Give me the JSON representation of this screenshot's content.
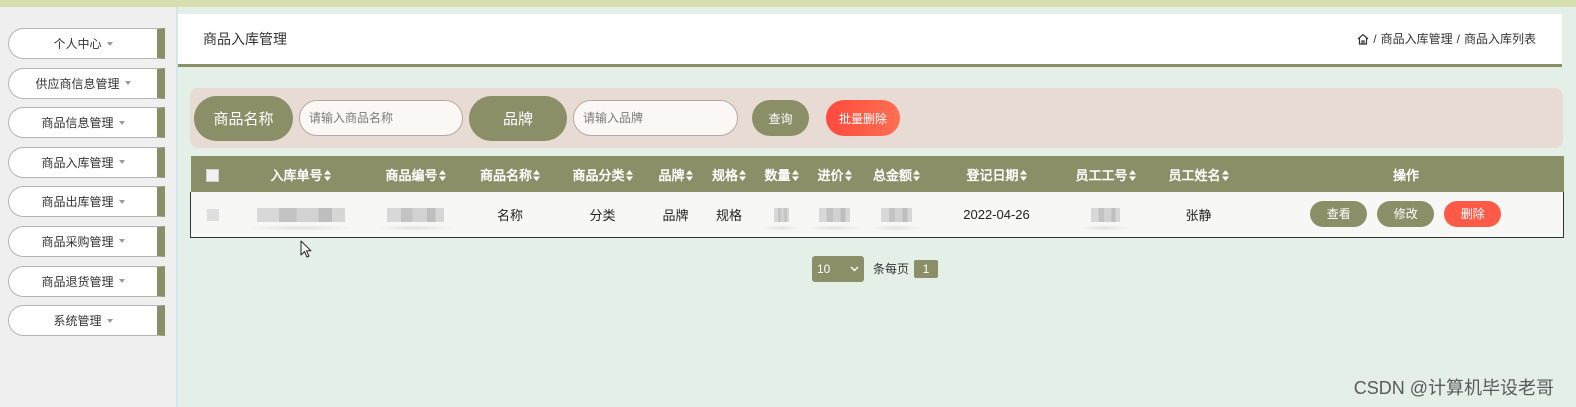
{
  "colors": {
    "accent": "#8b8f68",
    "danger": "#ff5a48",
    "search_panel_bg": "#e8dbd3",
    "main_bg": "#e3efe7"
  },
  "icons": {
    "home": "home-icon",
    "sort": "sort-icon",
    "dropdown": "caret-down-icon"
  },
  "sidebar": {
    "items": [
      {
        "label": "个人中心"
      },
      {
        "label": "供应商信息管理"
      },
      {
        "label": "商品信息管理"
      },
      {
        "label": "商品入库管理"
      },
      {
        "label": "商品出库管理"
      },
      {
        "label": "商品采购管理"
      },
      {
        "label": "商品退货管理"
      },
      {
        "label": "系统管理"
      }
    ]
  },
  "header": {
    "title": "商品入库管理",
    "breadcrumb": {
      "separator": "/",
      "items": [
        "商品入库管理",
        "商品入库列表"
      ]
    }
  },
  "search": {
    "name_label": "商品名称",
    "name_placeholder": "请输入商品名称",
    "brand_label": "品牌",
    "brand_placeholder": "请输入品牌",
    "query_button": "查询",
    "batch_delete_button": "批量删除"
  },
  "table": {
    "columns": [
      "入库单号",
      "商品编号",
      "商品名称",
      "商品分类",
      "品牌",
      "规格",
      "数量",
      "进价",
      "总金额",
      "登记日期",
      "员工工号",
      "员工姓名",
      "操作"
    ],
    "rows": [
      {
        "name": "名称",
        "category": "分类",
        "brand": "品牌",
        "spec": "规格",
        "date": "2022-04-26",
        "staff_name": "张静"
      }
    ],
    "actions": {
      "view": "查看",
      "edit": "修改",
      "delete": "删除"
    }
  },
  "pagination": {
    "page_size": "10",
    "per_page_label": "条每页",
    "current_page": "1"
  },
  "watermark": "CSDN @计算机毕设老哥"
}
